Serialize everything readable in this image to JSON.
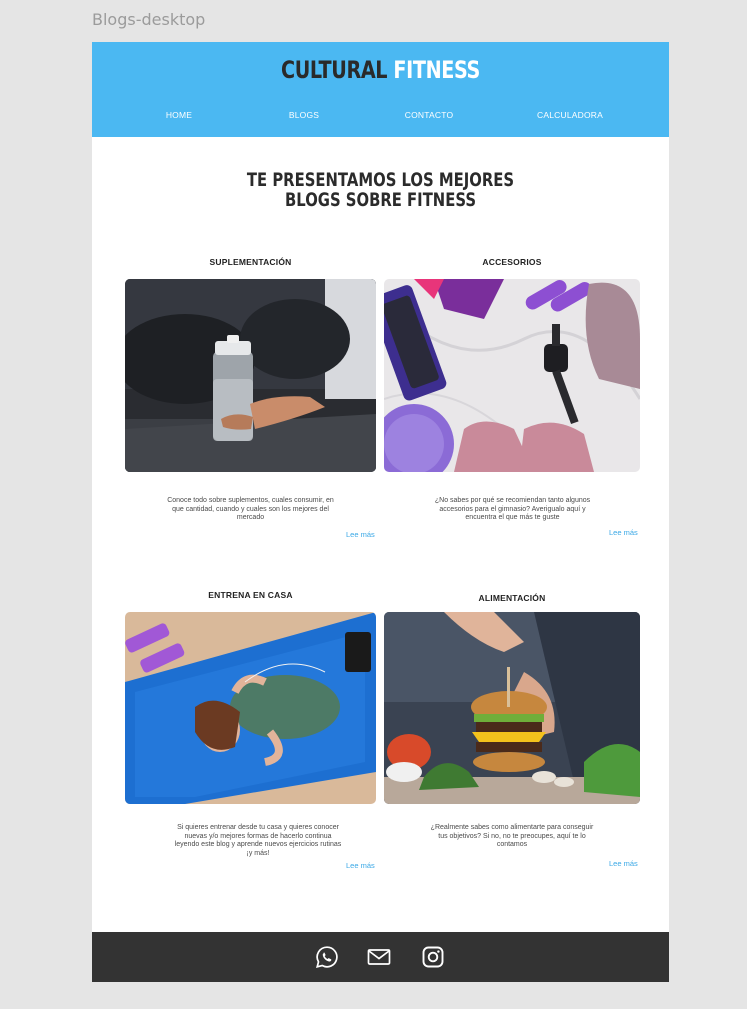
{
  "frame_label": "Blogs-desktop",
  "brand": {
    "part1": "CULTURAL",
    "part2": "FITNESS"
  },
  "nav": [
    "HOME",
    "BLOGS",
    "CONTACTO",
    "CALCULADORA"
  ],
  "hero": {
    "line1": "TE PRESENTAMOS LOS MEJORES",
    "line2": "BLOGS SOBRE FITNESS"
  },
  "cards": [
    {
      "title": "SUPLEMENTACIÓN",
      "description": "Conoce todo sobre suplementos, cuales consumir, en que cantidad, cuando y cuales son los mejores del mercado",
      "link": "Lee más"
    },
    {
      "title": "ACCESORIOS",
      "description": "¿No sabes por qué se recomiendan tanto algunos accesorios para el gimnasio? Averigualo aquí y encuentra el que más te guste",
      "link": "Lee más"
    },
    {
      "title": "ENTRENA EN CASA",
      "description": "Si quieres entrenar desde tu casa y quieres conocer nuevas y/o mejores formas de hacerlo continua leyendo este blog y aprende nuevos ejercicios rutinas ¡y más!",
      "link": "Lee más"
    },
    {
      "title": "ALIMENTACIÓN",
      "description": "¿Realmente sabes como alimentarte para conseguir tus objetivos? Si no, no te preocupes, aquí te lo contamos",
      "link": "Lee más"
    }
  ],
  "footer_icons": [
    "whatsapp-icon",
    "mail-icon",
    "instagram-icon"
  ],
  "colors": {
    "header": "#4bb8f2",
    "footer": "#333333",
    "link": "#3aa8e6",
    "brand_dark": "#2a2a2a"
  }
}
